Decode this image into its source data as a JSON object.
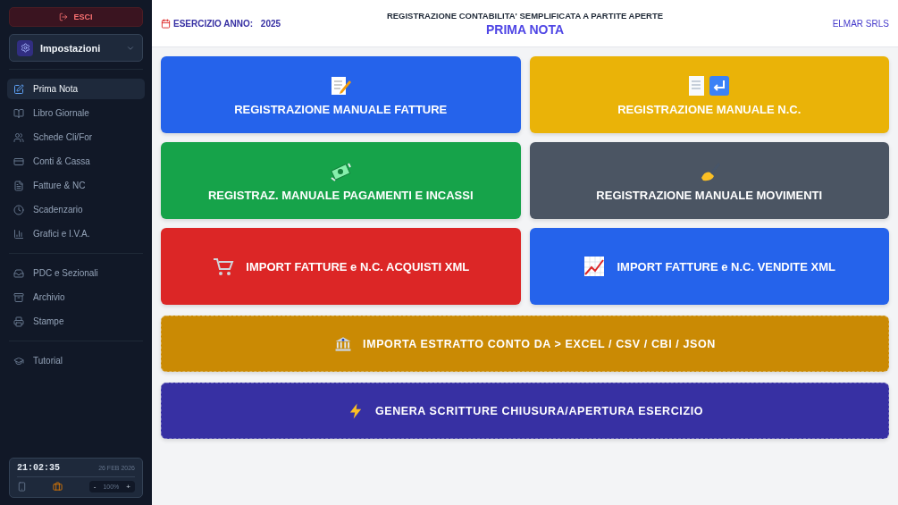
{
  "sidebar": {
    "logout": "ESCI",
    "settings": "Impostazioni",
    "groups": [
      [
        {
          "label": "Prima Nota",
          "selected": true
        },
        {
          "label": "Libro Giornale",
          "selected": false
        },
        {
          "label": "Schede Cli/For",
          "selected": false
        },
        {
          "label": "Conti & Cassa",
          "selected": false
        },
        {
          "label": "Fatture & NC",
          "selected": false
        },
        {
          "label": "Scadenzario",
          "selected": false
        },
        {
          "label": "Grafici e I.V.A.",
          "selected": false
        }
      ],
      [
        {
          "label": "PDC e Sezionali",
          "selected": false
        },
        {
          "label": "Archivio",
          "selected": false
        },
        {
          "label": "Stampe",
          "selected": false
        }
      ],
      [
        {
          "label": "Tutorial",
          "selected": false
        }
      ]
    ],
    "clock": {
      "time": "21:02:35",
      "date": "26 FEB 2026",
      "zoom": "100%",
      "zoom_out": "-",
      "zoom_in": "+"
    }
  },
  "header": {
    "year_label": "ESERCIZIO ANNO:",
    "year": "2025",
    "subtitle": "REGISTRAZIONE CONTABILITA' SEMPLIFICATA A PARTITE APERTE",
    "title": "PRIMA NOTA",
    "company": "ELMAR SRLS"
  },
  "tiles": [
    {
      "label": "REGISTRAZIONE MANUALE FATTURE",
      "kind": "stacked",
      "color": "#2563eb"
    },
    {
      "label": "REGISTRAZIONE MANUALE N.C.",
      "kind": "stacked",
      "color": "#eab308"
    },
    {
      "label": "REGISTRAZ. MANUALE PAGAMENTI E INCASSI",
      "kind": "stacked",
      "color": "#16a34a"
    },
    {
      "label": "REGISTRAZIONE MANUALE MOVIMENTI",
      "kind": "stacked",
      "color": "#4b5563"
    },
    {
      "label": "IMPORT FATTURE e N.C. ACQUISTI XML",
      "kind": "inline",
      "color": "#dc2626"
    },
    {
      "label": "IMPORT FATTURE e N.C. VENDITE XML",
      "kind": "inline",
      "color": "#2563eb"
    },
    {
      "label": "IMPORTA ESTRATTO CONTO DA > EXCEL / CSV / CBI / JSON",
      "kind": "wide",
      "color": "#ca8a04"
    },
    {
      "label": "GENERA SCRITTURE CHIUSURA/APERTURA ESERCIZIO",
      "kind": "wide",
      "color": "#3730a3"
    }
  ]
}
